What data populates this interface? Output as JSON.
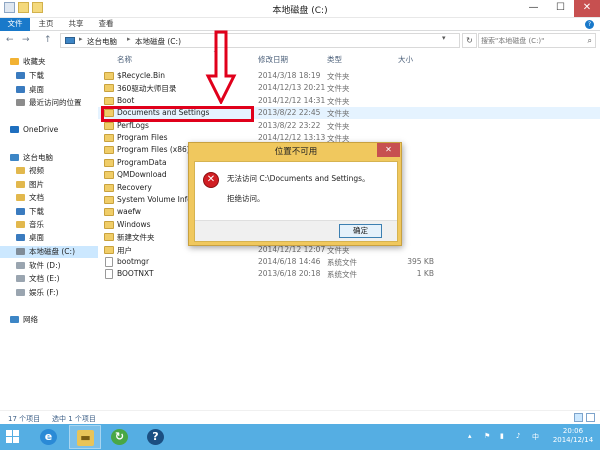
{
  "window": {
    "title": "本地磁盘 (C:)",
    "min_glyph": "—",
    "max_glyph": "☐",
    "close_glyph": "✕"
  },
  "ribbon": {
    "tabs": [
      "文件",
      "主页",
      "共享",
      "查看"
    ],
    "help_glyph": "?"
  },
  "nav_buttons": {
    "back": "←",
    "forward": "→",
    "up": "↑"
  },
  "address": {
    "crumbs": [
      "这台电脑",
      "本地磁盘 (C:)"
    ],
    "separator": "▸",
    "dropdown": "▾",
    "refresh": "↻"
  },
  "search": {
    "placeholder": "搜索\"本地磁盘 (C:)\"",
    "icon": "search-icon",
    "glyph": "⌕"
  },
  "sidebar": {
    "items": [
      {
        "label": "收藏夹",
        "icon": "star-icon",
        "color": "#f2b233"
      },
      {
        "label": "下载",
        "icon": "download-folder-icon",
        "color": "#3a7bbf"
      },
      {
        "label": "桌面",
        "icon": "desktop-icon",
        "color": "#3a7bbf"
      },
      {
        "label": "最近访问的位置",
        "icon": "recent-places-icon",
        "color": "#8c8c8c"
      },
      {
        "label": "OneDrive",
        "icon": "onedrive-icon",
        "color": "#1f6fbf"
      },
      {
        "label": "这台电脑",
        "icon": "computer-icon",
        "color": "#3d86c6"
      },
      {
        "label": "视频",
        "icon": "videos-folder-icon",
        "color": "#e2b84d"
      },
      {
        "label": "图片",
        "icon": "pictures-folder-icon",
        "color": "#e2b84d"
      },
      {
        "label": "文档",
        "icon": "documents-folder-icon",
        "color": "#e2b84d"
      },
      {
        "label": "下载",
        "icon": "download-folder-icon",
        "color": "#3a7bbf"
      },
      {
        "label": "音乐",
        "icon": "music-folder-icon",
        "color": "#e2b84d"
      },
      {
        "label": "桌面",
        "icon": "desktop-icon",
        "color": "#3a7bbf"
      },
      {
        "label": "本地磁盘 (C:)",
        "icon": "drive-icon",
        "color": "#7f8c99"
      },
      {
        "label": "软件 (D:)",
        "icon": "drive-icon",
        "color": "#9aa5b0"
      },
      {
        "label": "文档 (E:)",
        "icon": "drive-icon",
        "color": "#9aa5b0"
      },
      {
        "label": "娱乐 (F:)",
        "icon": "drive-icon",
        "color": "#9aa5b0"
      },
      {
        "label": "网络",
        "icon": "network-icon",
        "color": "#3d86c6"
      }
    ]
  },
  "columns": {
    "name": "名称",
    "date": "修改日期",
    "type": "类型",
    "size": "大小",
    "sort_glyph": "^"
  },
  "files": [
    {
      "name": "$Recycle.Bin",
      "date": "2014/3/18 18:19",
      "type": "文件夹",
      "size": "",
      "kind": "folder"
    },
    {
      "name": "360驱动大师目录",
      "date": "2014/12/13 20:21",
      "type": "文件夹",
      "size": "",
      "kind": "folder"
    },
    {
      "name": "Boot",
      "date": "2014/12/12 14:31",
      "type": "文件夹",
      "size": "",
      "kind": "folder"
    },
    {
      "name": "Documents and Settings",
      "date": "2013/8/22 22:45",
      "type": "文件夹",
      "size": "",
      "kind": "folder"
    },
    {
      "name": "PerfLogs",
      "date": "2013/8/22 23:22",
      "type": "文件夹",
      "size": "",
      "kind": "folder"
    },
    {
      "name": "Program Files",
      "date": "2014/12/12 13:13",
      "type": "文件夹",
      "size": "",
      "kind": "folder"
    },
    {
      "name": "Program Files (x86)",
      "date": "",
      "type": "",
      "size": "",
      "kind": "folder"
    },
    {
      "name": "ProgramData",
      "date": "",
      "type": "",
      "size": "",
      "kind": "folder"
    },
    {
      "name": "QMDownload",
      "date": "",
      "type": "",
      "size": "",
      "kind": "folder"
    },
    {
      "name": "Recovery",
      "date": "",
      "type": "",
      "size": "",
      "kind": "folder"
    },
    {
      "name": "System Volume Information",
      "date": "",
      "type": "",
      "size": "",
      "kind": "folder"
    },
    {
      "name": "waefw",
      "date": "",
      "type": "",
      "size": "",
      "kind": "folder"
    },
    {
      "name": "Windows",
      "date": "",
      "type": "",
      "size": "",
      "kind": "folder"
    },
    {
      "name": "新建文件夹",
      "date": "",
      "type": "",
      "size": "",
      "kind": "folder"
    },
    {
      "name": "用户",
      "date": "2014/12/12 12:07",
      "type": "文件夹",
      "size": "",
      "kind": "folder"
    },
    {
      "name": "bootmgr",
      "date": "2014/6/18 14:46",
      "type": "系统文件",
      "size": "395 KB",
      "kind": "file"
    },
    {
      "name": "BOOTNXT",
      "date": "2013/6/18 20:18",
      "type": "系统文件",
      "size": "1 KB",
      "kind": "file"
    }
  ],
  "dialog": {
    "title": "位置不可用",
    "close_glyph": "✕",
    "icon": "error-icon",
    "icon_glyph": "✕",
    "message": "无法访问 C:\\Documents and Settings。",
    "detail": "拒绝访问。",
    "ok_label": "确定"
  },
  "status": {
    "item_count": "17 个项目",
    "selected": "选中 1 个项目"
  },
  "taskbar": {
    "apps": [
      {
        "name": "internet-explorer-icon",
        "glyph": "e",
        "color": "#2a8ad6"
      },
      {
        "name": "file-explorer-icon",
        "glyph": "▬",
        "color": "#e8c458"
      },
      {
        "name": "360-browser-icon",
        "glyph": "↻",
        "color": "#49a745"
      },
      {
        "name": "help-icon",
        "glyph": "?",
        "color": "#1b4f82"
      }
    ],
    "tray_glyphs": [
      "▴",
      "⚑",
      "▮",
      "♪",
      "中"
    ],
    "time": "20:06",
    "date": "2014/12/14"
  },
  "annotation_color": "#e0001b"
}
